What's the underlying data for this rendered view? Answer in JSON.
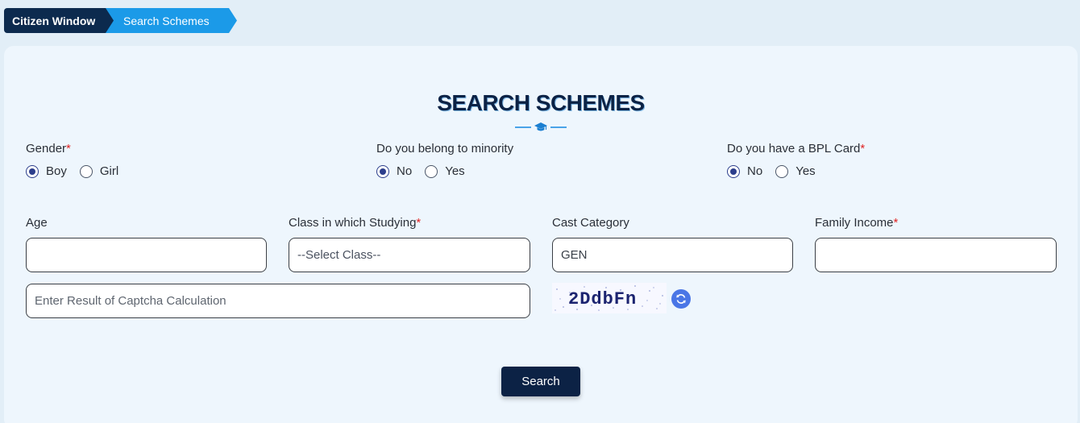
{
  "breadcrumb": {
    "items": [
      "Citizen Window",
      "Search Schemes"
    ]
  },
  "page": {
    "title": "SEARCH SCHEMES"
  },
  "form": {
    "gender": {
      "label": "Gender",
      "required_mark": "*",
      "options": [
        "Boy",
        "Girl"
      ],
      "selected": "Boy"
    },
    "minority": {
      "label": "Do you belong to minority",
      "options": [
        "No",
        "Yes"
      ],
      "selected": "No"
    },
    "bpl": {
      "label": "Do you have a BPL Card",
      "required_mark": "*",
      "options": [
        "No",
        "Yes"
      ],
      "selected": "No"
    },
    "age": {
      "label": "Age",
      "value": ""
    },
    "class": {
      "label": "Class in which Studying",
      "required_mark": "*",
      "selected": "--Select Class--"
    },
    "cast_category": {
      "label": "Cast Category",
      "value": "GEN"
    },
    "family_income": {
      "label": "Family Income",
      "required_mark": "*",
      "value": ""
    },
    "captcha": {
      "placeholder": "Enter Result of Captcha Calculation",
      "image_text": "2DdbFn"
    },
    "search_label": "Search"
  },
  "colors": {
    "primary_dark": "#0c2245",
    "accent_blue": "#1b9ae8",
    "required": "#e02424",
    "refresh": "#4a76e6"
  },
  "icons": [
    "graduation-cap-icon",
    "refresh-icon"
  ]
}
